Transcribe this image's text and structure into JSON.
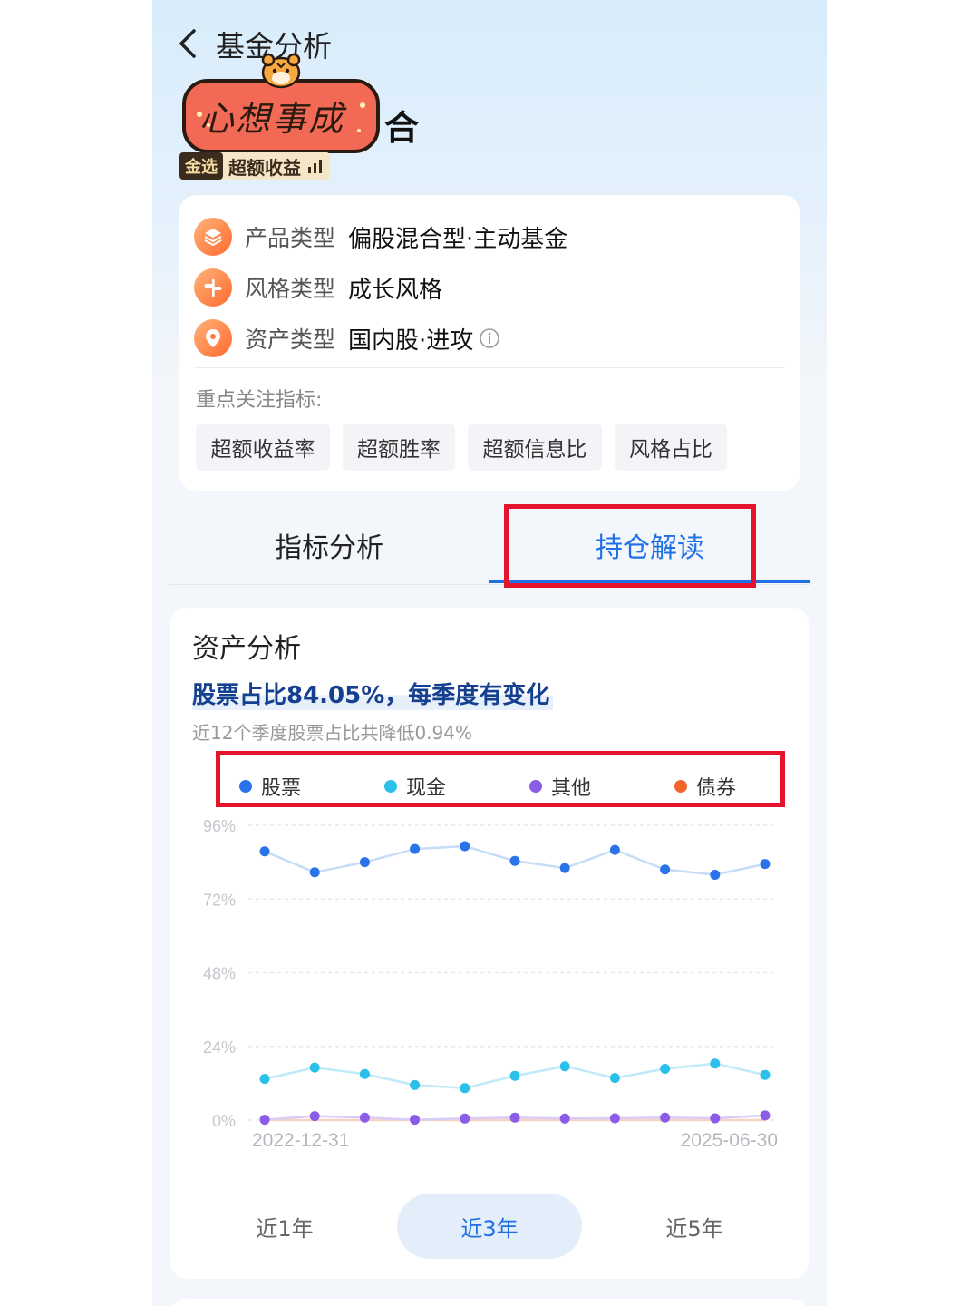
{
  "header": {
    "title": "基金分析"
  },
  "fund": {
    "name_tail": "合",
    "sticker_text": "心想事成",
    "badge_tag": "金选",
    "badge_label": "超额收益"
  },
  "info": {
    "rows": [
      {
        "label": "产品类型",
        "value": "偏股混合型·主动基金"
      },
      {
        "label": "风格类型",
        "value": "成长风格"
      },
      {
        "label": "资产类型",
        "value": "国内股·进攻"
      }
    ],
    "focus_label": "重点关注指标:",
    "chips": [
      "超额收益率",
      "超额胜率",
      "超额信息比",
      "风格占比"
    ]
  },
  "tabs": {
    "items": [
      "指标分析",
      "持仓解读"
    ],
    "active_index": 1
  },
  "asset": {
    "title": "资产分析",
    "headline": "股票占比84.05%，每季度有变化",
    "subtitle": "近12个季度股票占比共降低0.94%",
    "ranges": [
      "近1年",
      "近3年",
      "近5年"
    ],
    "active_range": 1
  },
  "colors": {
    "accent": "#1f6fe5",
    "stock": "#2a73ea",
    "cash": "#2ac0ea",
    "other": "#8b5ce6",
    "bond": "#f2642a",
    "annotation": "#e3142b"
  },
  "chart_data": {
    "type": "line",
    "x": [
      "2022-12-31",
      "2023-03-31",
      "2023-06-30",
      "2023-09-30",
      "2023-12-31",
      "2024-03-31",
      "2024-06-30",
      "2024-09-30",
      "2024-12-31",
      "2025-03-31",
      "2025-06-30"
    ],
    "x_tick_labels": [
      "2022-12-31",
      "2025-06-30"
    ],
    "y_tick_labels": [
      "96%",
      "72%",
      "48%",
      "24%",
      "0%"
    ],
    "ylim": [
      0,
      96
    ],
    "grid": true,
    "legend_position": "top",
    "series": [
      {
        "name": "股票",
        "color": "#2a73ea",
        "line_color": "#c7dcf7",
        "values": [
          87.5,
          80.7,
          84.0,
          88.3,
          89.2,
          84.4,
          82.1,
          88.0,
          81.6,
          79.9,
          83.4
        ]
      },
      {
        "name": "现金",
        "color": "#2ac0ea",
        "line_color": "#bfeaf7",
        "values": [
          13.4,
          17.1,
          15.0,
          11.4,
          10.4,
          14.4,
          17.5,
          13.7,
          16.7,
          18.4,
          14.7
        ]
      },
      {
        "name": "其他",
        "color": "#8b5ce6",
        "line_color": "#d9cdf7",
        "values": [
          0.1,
          1.3,
          0.8,
          0.1,
          0.5,
          0.8,
          0.5,
          0.6,
          0.8,
          0.6,
          1.5
        ]
      },
      {
        "name": "债券",
        "color": "#f2642a",
        "line_color": "#f8d2c3",
        "values": [
          0,
          0,
          0,
          0,
          0,
          0,
          0,
          0,
          0,
          0,
          0
        ]
      }
    ]
  }
}
